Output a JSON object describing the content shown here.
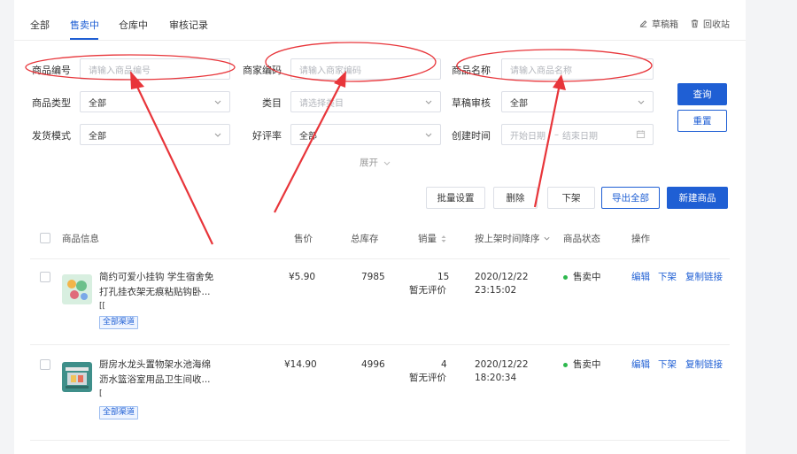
{
  "tabs": [
    {
      "label": "全部",
      "active": false
    },
    {
      "label": "售卖中",
      "active": true
    },
    {
      "label": "仓库中",
      "active": false
    },
    {
      "label": "审核记录",
      "active": false
    }
  ],
  "tools": {
    "drafts": "草稿箱",
    "recycle": "回收站"
  },
  "filters": {
    "product_code": {
      "label": "商品编号",
      "placeholder": "请输入商品编号"
    },
    "merchant_code": {
      "label": "商家编码",
      "placeholder": "请输入商家编码"
    },
    "product_name": {
      "label": "商品名称",
      "placeholder": "请输入商品名称"
    },
    "product_type": {
      "label": "商品类型",
      "value": "全部"
    },
    "category": {
      "label": "类目",
      "placeholder": "请选择类目"
    },
    "draft_review": {
      "label": "草稿审核",
      "value": "全部"
    },
    "shipping_mode": {
      "label": "发货模式",
      "value": "全部"
    },
    "rating": {
      "label": "好评率",
      "value": "全部"
    },
    "created_time": {
      "label": "创建时间",
      "start_placeholder": "开始日期",
      "separator": "–",
      "end_placeholder": "结束日期"
    },
    "expand": "展开"
  },
  "buttons": {
    "query": "查询",
    "reset": "重置",
    "batch": "批量设置",
    "delete": "删除",
    "offline": "下架",
    "export_all": "导出全部",
    "new_product": "新建商品"
  },
  "table": {
    "headers": {
      "info": "商品信息",
      "price": "售价",
      "stock": "总库存",
      "sales": "销量",
      "listed": "按上架时间降序",
      "status": "商品状态",
      "ops": "操作"
    },
    "rows": [
      {
        "title_line1": "简约可爱小挂钩 学生宿舍免",
        "title_line2": "打孔挂衣架无痕粘贴钩卧...",
        "extra": "[[",
        "tag": "全部渠道",
        "price": "¥5.90",
        "stock": "7985",
        "sales": "15",
        "rating": "暂无评价",
        "date": "2020/12/22",
        "time": "23:15:02",
        "status": "售卖中",
        "op_edit": "编辑",
        "op_offline": "下架",
        "op_copy": "复制链接"
      },
      {
        "title_line1": "厨房水龙头置物架水池海绵",
        "title_line2": "沥水篮浴室用品卫生间收...",
        "extra": "[",
        "tag": "全部渠道",
        "price": "¥14.90",
        "stock": "4996",
        "sales": "4",
        "rating": "暂无评价",
        "date": "2020/12/22",
        "time": "18:20:34",
        "status": "售卖中",
        "op_edit": "编辑",
        "op_offline": "下架",
        "op_copy": "复制链接"
      }
    ]
  },
  "colors": {
    "accent": "#1f5fd4",
    "annotation": "#e8353a",
    "status_green": "#2db84d"
  }
}
